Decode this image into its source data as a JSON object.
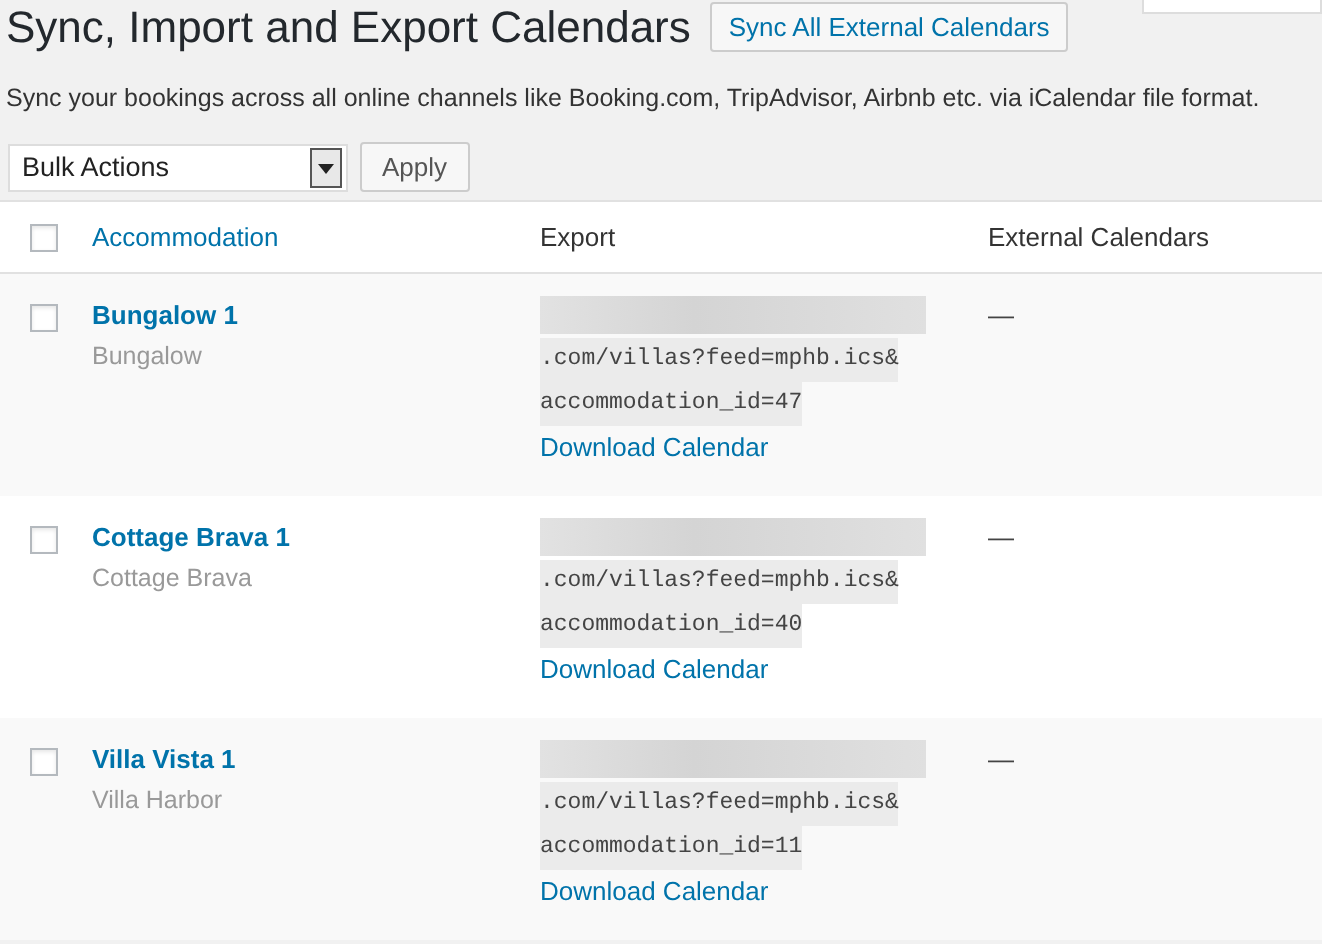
{
  "title": "Sync, Import and Export Calendars",
  "sync_button": "Sync All External Calendars",
  "description": "Sync your bookings across all online channels like Booking.com, TripAdvisor, Airbnb etc. via iCalendar file format.",
  "bulk_actions": {
    "value": "Bulk Actions",
    "apply": "Apply"
  },
  "table": {
    "columns": [
      "Accommodation",
      "Export",
      "External Calendars"
    ],
    "select_all_checked": false,
    "rows": [
      {
        "name": "Bungalow 1",
        "type": "Bungalow",
        "checked": false,
        "export_lines": [
          ".com/villas?feed=mphb.ics&",
          "accommodation_id=47"
        ],
        "download": "Download Calendar",
        "external": "—"
      },
      {
        "name": "Cottage Brava 1",
        "type": "Cottage Brava",
        "checked": false,
        "export_lines": [
          ".com/villas?feed=mphb.ics&",
          "accommodation_id=40"
        ],
        "download": "Download Calendar",
        "external": "—"
      },
      {
        "name": "Villa Vista 1",
        "type": "Villa Harbor",
        "checked": false,
        "export_lines": [
          ".com/villas?feed=mphb.ics&",
          "accommodation_id=11"
        ],
        "download": "Download Calendar",
        "external": "—"
      }
    ]
  }
}
